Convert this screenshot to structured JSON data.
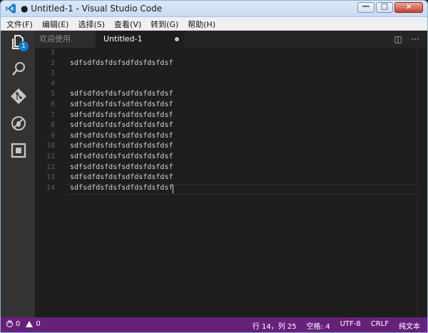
{
  "window": {
    "title": "● Untitled-1 - Visual Studio Code",
    "controls": {
      "minimize": "—",
      "maximize": "□",
      "close": "✕"
    }
  },
  "menu": [
    "文件(F)",
    "编辑(E)",
    "选择(S)",
    "查看(V)",
    "转到(G)",
    "帮助(H)"
  ],
  "activity_bar": {
    "items": [
      {
        "icon": "files-icon",
        "badge": "1"
      },
      {
        "icon": "search-icon"
      },
      {
        "icon": "git-icon"
      },
      {
        "icon": "debug-icon"
      },
      {
        "icon": "extensions-icon"
      }
    ],
    "explorer_badge": "1"
  },
  "tabs": {
    "welcome": "欢迎使用",
    "active": "Untitled-1",
    "actions": {
      "split": "◫",
      "more": "···"
    }
  },
  "editor": {
    "lines": [
      {
        "n": "1",
        "text": ""
      },
      {
        "n": "2",
        "text": "sdfsdfdsfdsfsdfdsfdsfdsf"
      },
      {
        "n": "3",
        "text": ""
      },
      {
        "n": "4",
        "text": ""
      },
      {
        "n": "5",
        "text": "sdfsdfdsfdsfsdfdsfdsfdsf"
      },
      {
        "n": "6",
        "text": "sdfsdfdsfdsfsdfdsfdsfdsf"
      },
      {
        "n": "7",
        "text": "sdfsdfdsfdsfsdfdsfdsfdsf"
      },
      {
        "n": "8",
        "text": "sdfsdfdsfdsfsdfdsfdsfdsf"
      },
      {
        "n": "9",
        "text": "sdfsdfdsfdsfsdfdsfdsfdsf"
      },
      {
        "n": "10",
        "text": "sdfsdfdsfdsfsdfdsfdsfdsf"
      },
      {
        "n": "11",
        "text": "sdfsdfdsfdsfsdfdsfdsfdsf"
      },
      {
        "n": "12",
        "text": "sdfsdfdsfdsfsdfdsfdsfdsf"
      },
      {
        "n": "13",
        "text": "sdfsdfdsfdsfsdfdsfdsfdsf"
      },
      {
        "n": "14",
        "text": "sdfsdfdsfdsfsdfdsfdsfdsf"
      }
    ],
    "current_line": 14
  },
  "status": {
    "errors": "0",
    "warnings": "0",
    "position": "行 14，列 25",
    "indent": "空格: 4",
    "encoding": "UTF-8",
    "eol": "CRLF",
    "language": "纯文本"
  },
  "colors": {
    "status_bar": "#68217a",
    "activity_bar": "#333333",
    "editor_bg": "#1e1e1e",
    "badge": "#0e7bd1"
  }
}
